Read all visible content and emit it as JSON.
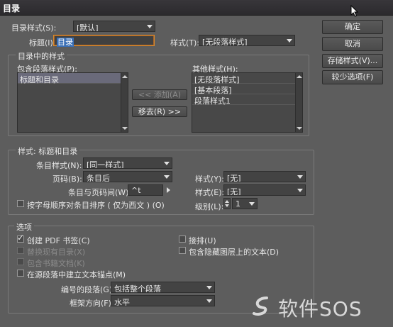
{
  "window": {
    "title": "目录"
  },
  "top": {
    "toc_style_label": "目录样式(S):",
    "toc_style_value": "[默认]",
    "title_label": "标题(I):",
    "title_value": "目录",
    "style_label": "样式(T):",
    "style_value": "[无段落样式]"
  },
  "buttons": {
    "ok": "确定",
    "cancel": "取消",
    "save_style": "存储样式(V)...",
    "fewer_options": "较少选项(F)",
    "add": "<< 添加(A)",
    "remove": "移去(R) >>"
  },
  "styles_group": {
    "title": "目录中的样式",
    "include_label": "包含段落样式(P):",
    "include_items": [
      "标题和目录"
    ],
    "other_label": "其他样式(H):",
    "other_items": [
      "[无段落样式]",
      "[基本段落]",
      "段落样式1"
    ]
  },
  "style_group": {
    "title": "样式: 标题和目录",
    "entry_style_label": "条目样式(N):",
    "entry_style_value": "[同一样式]",
    "page_label": "页码(B):",
    "page_value": "条目后",
    "style_y_label": "样式(Y):",
    "style_y_value": "[无]",
    "between_label": "条目与页码间(W):",
    "between_value": "^t",
    "style_e_label": "样式(E):",
    "style_e_value": "[无]",
    "sort_label": "按字母顺序对条目排序 ( 仅为西文 ) (O)",
    "level_label": "级别(L):",
    "level_value": "1"
  },
  "options_group": {
    "title": "选项",
    "create_pdf": "创建 PDF 书签(C)",
    "replace_existing": "替换现有目录(X)",
    "include_book": "包含书籍文档(K)",
    "create_anchor": "在源段落中建立文本锚点(M)",
    "run_in": "接排(U)",
    "include_hidden": "包含隐藏图层上的文本(D)",
    "numbered_label": "编号的段落(G):",
    "numbered_value": "包括整个段落",
    "frame_dir_label": "框架方向(F):",
    "frame_dir_value": "水平"
  },
  "watermark": {
    "text": "软件SOS"
  }
}
